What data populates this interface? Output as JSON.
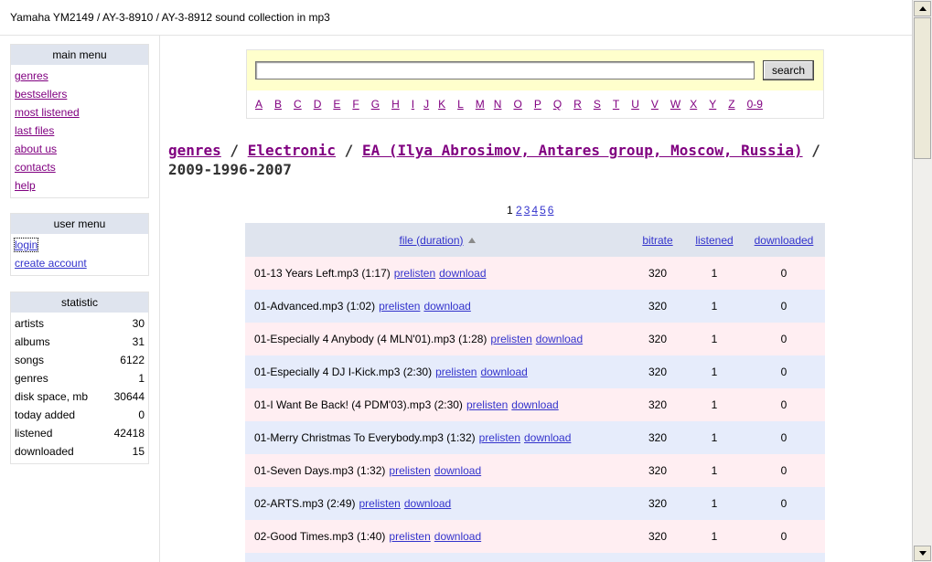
{
  "header": {
    "title": "Yamaha YM2149 / AY-3-8910 / AY-3-8912 sound collection in mp3"
  },
  "main_menu": {
    "title": "main menu",
    "items": [
      "genres",
      "bestsellers",
      "most listened",
      "last files",
      "about us",
      "contacts",
      "help"
    ]
  },
  "user_menu": {
    "title": "user menu",
    "items": [
      "login",
      "create account"
    ]
  },
  "statistic": {
    "title": "statistic",
    "rows": [
      {
        "label": "artists",
        "value": "30"
      },
      {
        "label": "albums",
        "value": "31"
      },
      {
        "label": "songs",
        "value": "6122"
      },
      {
        "label": "genres",
        "value": "1"
      },
      {
        "label": "disk space, mb",
        "value": "30644"
      },
      {
        "label": "today added",
        "value": "0"
      },
      {
        "label": "listened",
        "value": "42418"
      },
      {
        "label": "downloaded",
        "value": "15"
      }
    ]
  },
  "search": {
    "value": "",
    "button_label": "search"
  },
  "letters": [
    "A",
    "B",
    "C",
    "D",
    "E",
    "F",
    "G",
    "H",
    "I",
    "J",
    "K",
    "L",
    "M",
    "N",
    "O",
    "P",
    "Q",
    "R",
    "S",
    "T",
    "U",
    "V",
    "W",
    "X",
    "Y",
    "Z",
    "0-9"
  ],
  "breadcrumb": {
    "part1": "genres",
    "sep1": " / ",
    "part2": "Electronic",
    "sep2": " / ",
    "part3": "EA (Ilya Abrosimov, Antares group, Moscow, Russia)",
    "sep3": " / ",
    "current": "2009-1996-2007"
  },
  "pager": {
    "current": "1",
    "pages": [
      "2",
      "3",
      "4",
      "5",
      "6"
    ]
  },
  "table": {
    "headers": {
      "file": "file (duration)",
      "bitrate": "bitrate",
      "listened": "listened",
      "downloaded": "downloaded"
    },
    "prelisten_label": "prelisten",
    "download_label": "download",
    "rows": [
      {
        "file": "01-13 Years Left.mp3 (1:17)",
        "bitrate": "320",
        "listened": "1",
        "downloaded": "0"
      },
      {
        "file": "01-Advanced.mp3 (1:02)",
        "bitrate": "320",
        "listened": "1",
        "downloaded": "0"
      },
      {
        "file": "01-Especially 4 Anybody (4 MLN'01).mp3 (1:28)",
        "bitrate": "320",
        "listened": "1",
        "downloaded": "0"
      },
      {
        "file": "01-Especially 4 DJ I-Kick.mp3 (2:30)",
        "bitrate": "320",
        "listened": "1",
        "downloaded": "0"
      },
      {
        "file": "01-I Want Be Back! (4 PDM'03).mp3 (2:30)",
        "bitrate": "320",
        "listened": "1",
        "downloaded": "0"
      },
      {
        "file": "01-Merry Christmas To Everybody.mp3 (1:32)",
        "bitrate": "320",
        "listened": "1",
        "downloaded": "0"
      },
      {
        "file": "01-Seven Days.mp3 (1:32)",
        "bitrate": "320",
        "listened": "1",
        "downloaded": "0"
      },
      {
        "file": "02-ARTS.mp3 (2:49)",
        "bitrate": "320",
        "listened": "1",
        "downloaded": "0"
      },
      {
        "file": "02-Good Times.mp3 (1:40)",
        "bitrate": "320",
        "listened": "1",
        "downloaded": "0"
      }
    ]
  }
}
